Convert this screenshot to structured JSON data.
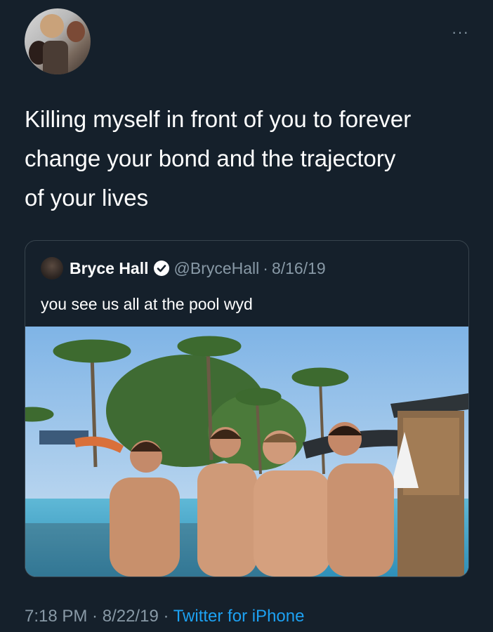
{
  "header": {
    "more_label": "···"
  },
  "tweet": {
    "text": "Killing myself in front of you to forever\nchange your bond and the trajectory\nof your lives"
  },
  "quoted": {
    "name": "Bryce Hall",
    "handle": "@BryceHall",
    "separator": "·",
    "date": "8/16/19",
    "text": "you see us all at the pool wyd"
  },
  "footer": {
    "time": "7:18 PM",
    "sep1": " · ",
    "date": "8/22/19",
    "sep2": " · ",
    "source": "Twitter for iPhone"
  },
  "colors": {
    "background": "#15202b",
    "text": "#ffffff",
    "secondary": "#8899a6",
    "accent": "#1da1f2",
    "border": "#38444d"
  },
  "icons": {
    "more": "more-horizontal-icon",
    "verified": "verified-badge-icon"
  }
}
